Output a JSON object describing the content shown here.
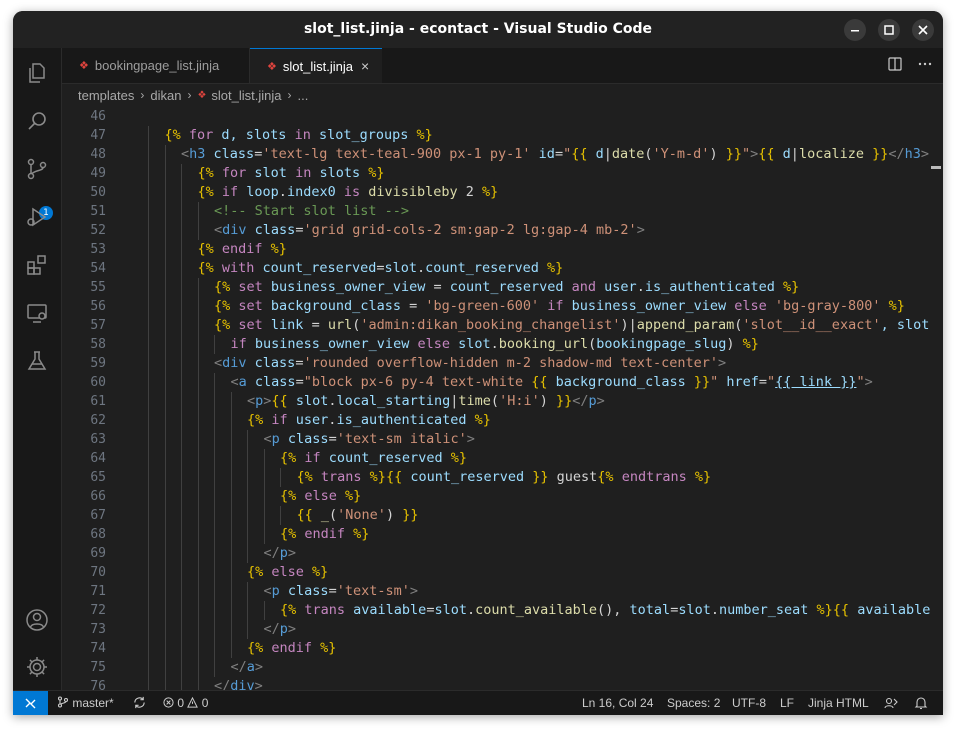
{
  "window": {
    "title": "slot_list.jinja - econtact - Visual Studio Code"
  },
  "tabs": [
    {
      "label": "bookingpage_list.jinja",
      "active": false
    },
    {
      "label": "slot_list.jinja",
      "active": true,
      "close": "×"
    }
  ],
  "breadcrumb": {
    "items": [
      "templates",
      "dikan",
      "slot_list.jinja",
      "..."
    ]
  },
  "activity_bar": {
    "icons": [
      "explorer-icon",
      "search-icon",
      "source-control-icon",
      "run-debug-icon",
      "extensions-icon",
      "remote-explorer-icon",
      "testing-icon",
      "account-icon",
      "settings-gear-icon"
    ],
    "source_control_badge": "1"
  },
  "colors": {
    "accent": "#0078d4",
    "editor_bg": "#1f1f1f",
    "keyword": "#c586c0",
    "jinja_delim": "#e6c100",
    "string": "#ce9178",
    "tag": "#569cd6",
    "comment": "#6a9955"
  },
  "editor": {
    "line_numbers": [
      "46",
      "47",
      "48",
      "49",
      "50",
      "51",
      "52",
      "53",
      "54",
      "55",
      "56",
      "57",
      "58",
      "59",
      "60",
      "61",
      "62",
      "63",
      "64",
      "65",
      "66",
      "67",
      "68",
      "69",
      "70",
      "71",
      "72",
      "73",
      "74",
      "75",
      "76"
    ],
    "lines": [
      {
        "indent": 0,
        "tokens": []
      },
      {
        "indent": 1,
        "tokens": [
          [
            "{% ",
            "d"
          ],
          [
            "for",
            "k"
          ],
          [
            " d, slots ",
            "v"
          ],
          [
            "in",
            "k"
          ],
          [
            " slot_groups ",
            "v"
          ],
          [
            "%}",
            "d"
          ]
        ]
      },
      {
        "indent": 2,
        "tokens": [
          [
            "<",
            "p"
          ],
          [
            "h3",
            "t"
          ],
          [
            " class",
            "a"
          ],
          [
            "=",
            "w"
          ],
          [
            "'text-lg text-teal-900 px-1 py-1'",
            "s"
          ],
          [
            " id",
            "a"
          ],
          [
            "=",
            "w"
          ],
          [
            "\"",
            "s"
          ],
          [
            "{{ ",
            "d"
          ],
          [
            "d",
            "v"
          ],
          [
            "|",
            "w"
          ],
          [
            "date",
            "f"
          ],
          [
            "(",
            "w"
          ],
          [
            "'Y-m-d'",
            "s"
          ],
          [
            ") ",
            "w"
          ],
          [
            "}}",
            "d"
          ],
          [
            "\"",
            "s"
          ],
          [
            ">",
            "p"
          ],
          [
            "{{ ",
            "d"
          ],
          [
            "d",
            "v"
          ],
          [
            "|",
            "w"
          ],
          [
            "localize ",
            "f"
          ],
          [
            "}}",
            "d"
          ],
          [
            "</",
            "p"
          ],
          [
            "h3",
            "t"
          ],
          [
            ">",
            "p"
          ]
        ]
      },
      {
        "indent": 3,
        "tokens": [
          [
            "{% ",
            "d"
          ],
          [
            "for",
            "k"
          ],
          [
            " slot ",
            "v"
          ],
          [
            "in",
            "k"
          ],
          [
            " slots ",
            "v"
          ],
          [
            "%}",
            "d"
          ]
        ]
      },
      {
        "indent": 3,
        "tokens": [
          [
            "{% ",
            "d"
          ],
          [
            "if",
            "k"
          ],
          [
            " loop",
            "v"
          ],
          [
            ".",
            "w"
          ],
          [
            "index0 ",
            "v"
          ],
          [
            "is",
            "k"
          ],
          [
            " divisibleby ",
            "f"
          ],
          [
            "2 ",
            "w"
          ],
          [
            "%}",
            "d"
          ]
        ]
      },
      {
        "indent": 4,
        "tokens": [
          [
            "<!-- Start slot list -->",
            "c"
          ]
        ]
      },
      {
        "indent": 4,
        "tokens": [
          [
            "<",
            "p"
          ],
          [
            "div",
            "t"
          ],
          [
            " class",
            "a"
          ],
          [
            "=",
            "w"
          ],
          [
            "'grid grid-cols-2 sm:gap-2 lg:gap-4 mb-2'",
            "s"
          ],
          [
            ">",
            "p"
          ]
        ]
      },
      {
        "indent": 3,
        "tokens": [
          [
            "{% ",
            "d"
          ],
          [
            "endif ",
            "k"
          ],
          [
            "%}",
            "d"
          ]
        ]
      },
      {
        "indent": 3,
        "tokens": [
          [
            "{% ",
            "d"
          ],
          [
            "with",
            "k"
          ],
          [
            " count_reserved",
            "v"
          ],
          [
            "=",
            "w"
          ],
          [
            "slot",
            "v"
          ],
          [
            ".",
            "w"
          ],
          [
            "count_reserved ",
            "v"
          ],
          [
            "%}",
            "d"
          ]
        ]
      },
      {
        "indent": 4,
        "tokens": [
          [
            "{% ",
            "d"
          ],
          [
            "set",
            "k"
          ],
          [
            " business_owner_view ",
            "v"
          ],
          [
            "= ",
            "w"
          ],
          [
            "count_reserved ",
            "v"
          ],
          [
            "and",
            "k"
          ],
          [
            " user",
            "v"
          ],
          [
            ".",
            "w"
          ],
          [
            "is_authenticated ",
            "v"
          ],
          [
            "%}",
            "d"
          ]
        ]
      },
      {
        "indent": 4,
        "tokens": [
          [
            "{% ",
            "d"
          ],
          [
            "set",
            "k"
          ],
          [
            " background_class ",
            "v"
          ],
          [
            "= ",
            "w"
          ],
          [
            "'bg-green-600'",
            "s"
          ],
          [
            " if",
            "k"
          ],
          [
            " business_owner_view ",
            "v"
          ],
          [
            "else",
            "k"
          ],
          [
            " 'bg-gray-800' ",
            "s"
          ],
          [
            "%}",
            "d"
          ]
        ]
      },
      {
        "indent": 4,
        "tokens": [
          [
            "{% ",
            "d"
          ],
          [
            "set",
            "k"
          ],
          [
            " link ",
            "v"
          ],
          [
            "= ",
            "w"
          ],
          [
            "url",
            "f"
          ],
          [
            "(",
            "w"
          ],
          [
            "'admin:dikan_booking_changelist'",
            "s"
          ],
          [
            ")|",
            "w"
          ],
          [
            "append_param",
            "f"
          ],
          [
            "(",
            "w"
          ],
          [
            "'slot__id__exact'",
            "s"
          ],
          [
            ", slot",
            "v"
          ]
        ]
      },
      {
        "indent": 5,
        "tokens": [
          [
            "if",
            "k"
          ],
          [
            " business_owner_view ",
            "v"
          ],
          [
            "else",
            "k"
          ],
          [
            " slot",
            "v"
          ],
          [
            ".",
            "w"
          ],
          [
            "booking_url",
            "f"
          ],
          [
            "(",
            "w"
          ],
          [
            "bookingpage_slug",
            "v"
          ],
          [
            ") ",
            "w"
          ],
          [
            "%}",
            "d"
          ]
        ]
      },
      {
        "indent": 4,
        "tokens": [
          [
            "<",
            "p"
          ],
          [
            "div",
            "t"
          ],
          [
            " class",
            "a"
          ],
          [
            "=",
            "w"
          ],
          [
            "'rounded overflow-hidden m-2 shadow-md text-center'",
            "s"
          ],
          [
            ">",
            "p"
          ]
        ]
      },
      {
        "indent": 5,
        "tokens": [
          [
            "<",
            "p"
          ],
          [
            "a",
            "t"
          ],
          [
            " class",
            "a"
          ],
          [
            "=",
            "w"
          ],
          [
            "\"block px-6 py-4 text-white ",
            "s"
          ],
          [
            "{{ ",
            "d"
          ],
          [
            "background_class ",
            "v"
          ],
          [
            "}}",
            "d"
          ],
          [
            "\"",
            "s"
          ],
          [
            " href",
            "a"
          ],
          [
            "=",
            "w"
          ],
          [
            "\"",
            "s"
          ],
          [
            "{{ link }}",
            "u"
          ],
          [
            "\"",
            "s"
          ],
          [
            ">",
            "p"
          ]
        ]
      },
      {
        "indent": 6,
        "tokens": [
          [
            "<",
            "p"
          ],
          [
            "p",
            "t"
          ],
          [
            ">",
            "p"
          ],
          [
            "{{ ",
            "d"
          ],
          [
            "slot",
            "v"
          ],
          [
            ".",
            "w"
          ],
          [
            "local_starting",
            "v"
          ],
          [
            "|",
            "w"
          ],
          [
            "time",
            "f"
          ],
          [
            "(",
            "w"
          ],
          [
            "'H:i'",
            "s"
          ],
          [
            ") ",
            "w"
          ],
          [
            "}}",
            "d"
          ],
          [
            "</",
            "p"
          ],
          [
            "p",
            "t"
          ],
          [
            ">",
            "p"
          ]
        ]
      },
      {
        "indent": 6,
        "tokens": [
          [
            "{% ",
            "d"
          ],
          [
            "if",
            "k"
          ],
          [
            " user",
            "v"
          ],
          [
            ".",
            "w"
          ],
          [
            "is_authenticated ",
            "v"
          ],
          [
            "%}",
            "d"
          ]
        ]
      },
      {
        "indent": 7,
        "tokens": [
          [
            "<",
            "p"
          ],
          [
            "p",
            "t"
          ],
          [
            " class",
            "a"
          ],
          [
            "=",
            "w"
          ],
          [
            "'text-sm italic'",
            "s"
          ],
          [
            ">",
            "p"
          ]
        ]
      },
      {
        "indent": 8,
        "tokens": [
          [
            "{% ",
            "d"
          ],
          [
            "if",
            "k"
          ],
          [
            " count_reserved ",
            "v"
          ],
          [
            "%}",
            "d"
          ]
        ]
      },
      {
        "indent": 9,
        "tokens": [
          [
            "{% ",
            "d"
          ],
          [
            "trans ",
            "k"
          ],
          [
            "%}",
            "d"
          ],
          [
            "{{ ",
            "d"
          ],
          [
            "count_reserved ",
            "v"
          ],
          [
            "}}",
            "d"
          ],
          [
            " guest",
            "w"
          ],
          [
            "{% ",
            "d"
          ],
          [
            "endtrans ",
            "k"
          ],
          [
            "%}",
            "d"
          ]
        ]
      },
      {
        "indent": 8,
        "tokens": [
          [
            "{% ",
            "d"
          ],
          [
            "else ",
            "k"
          ],
          [
            "%}",
            "d"
          ]
        ]
      },
      {
        "indent": 9,
        "tokens": [
          [
            "{{ ",
            "d"
          ],
          [
            "_",
            "f"
          ],
          [
            "(",
            "w"
          ],
          [
            "'None'",
            "s"
          ],
          [
            ") ",
            "w"
          ],
          [
            "}}",
            "d"
          ]
        ]
      },
      {
        "indent": 8,
        "tokens": [
          [
            "{% ",
            "d"
          ],
          [
            "endif ",
            "k"
          ],
          [
            "%}",
            "d"
          ]
        ]
      },
      {
        "indent": 7,
        "tokens": [
          [
            "</",
            "p"
          ],
          [
            "p",
            "t"
          ],
          [
            ">",
            "p"
          ]
        ]
      },
      {
        "indent": 6,
        "tokens": [
          [
            "{% ",
            "d"
          ],
          [
            "else ",
            "k"
          ],
          [
            "%}",
            "d"
          ]
        ]
      },
      {
        "indent": 7,
        "tokens": [
          [
            "<",
            "p"
          ],
          [
            "p",
            "t"
          ],
          [
            " class",
            "a"
          ],
          [
            "=",
            "w"
          ],
          [
            "'text-sm'",
            "s"
          ],
          [
            ">",
            "p"
          ]
        ]
      },
      {
        "indent": 8,
        "tokens": [
          [
            "{% ",
            "d"
          ],
          [
            "trans",
            "k"
          ],
          [
            " available",
            "v"
          ],
          [
            "=",
            "w"
          ],
          [
            "slot",
            "v"
          ],
          [
            ".",
            "w"
          ],
          [
            "count_available",
            "f"
          ],
          [
            "(), ",
            "w"
          ],
          [
            "total",
            "v"
          ],
          [
            "=",
            "w"
          ],
          [
            "slot",
            "v"
          ],
          [
            ".",
            "w"
          ],
          [
            "number_seat ",
            "v"
          ],
          [
            "%}",
            "d"
          ],
          [
            "{{ ",
            "d"
          ],
          [
            "available",
            "v"
          ]
        ]
      },
      {
        "indent": 7,
        "tokens": [
          [
            "</",
            "p"
          ],
          [
            "p",
            "t"
          ],
          [
            ">",
            "p"
          ]
        ]
      },
      {
        "indent": 6,
        "tokens": [
          [
            "{% ",
            "d"
          ],
          [
            "endif ",
            "k"
          ],
          [
            "%}",
            "d"
          ]
        ]
      },
      {
        "indent": 5,
        "tokens": [
          [
            "</",
            "p"
          ],
          [
            "a",
            "t"
          ],
          [
            ">",
            "p"
          ]
        ]
      },
      {
        "indent": 4,
        "tokens": [
          [
            "</",
            "p"
          ],
          [
            "div",
            "t"
          ],
          [
            ">",
            "p"
          ]
        ]
      }
    ]
  },
  "status_bar": {
    "branch": "master*",
    "problems": "0",
    "warnings": "0",
    "cursor": "Ln 16, Col 24",
    "spaces": "Spaces: 2",
    "encoding": "UTF-8",
    "eol": "LF",
    "language": "Jinja HTML"
  }
}
